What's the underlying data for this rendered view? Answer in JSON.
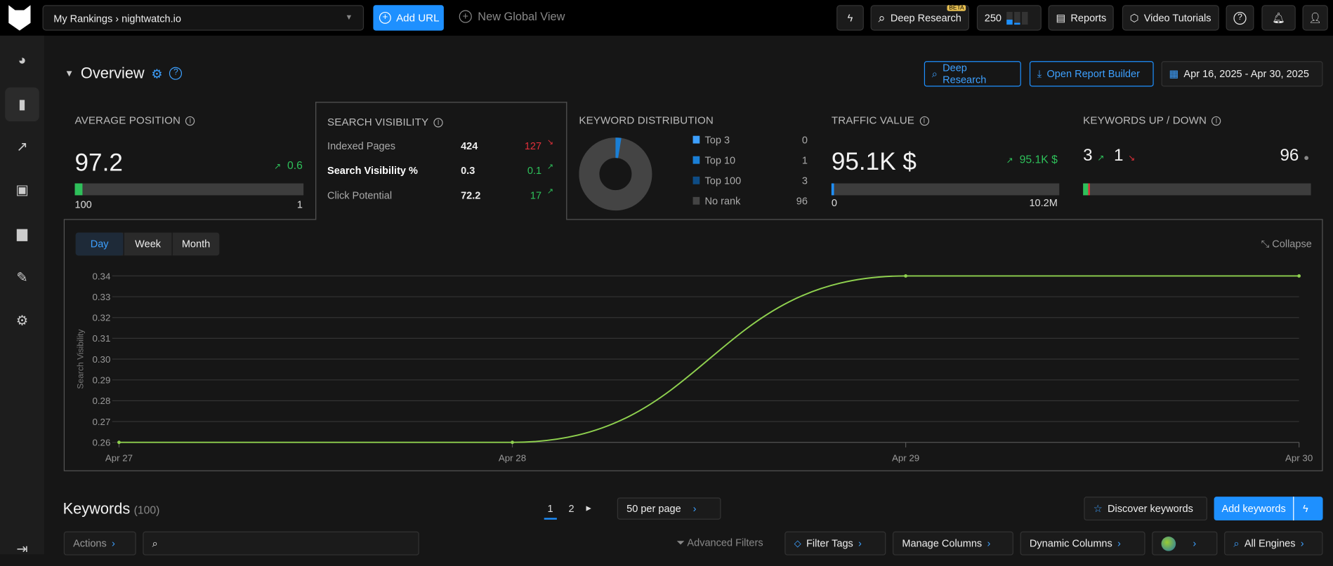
{
  "topbar": {
    "project_select": "My Rankings › nightwatch.io",
    "add_url": "Add URL",
    "new_global_view": "New Global View",
    "deep_research": "Deep Research",
    "beta_badge": "BETA",
    "credits": "250",
    "reports": "Reports",
    "video_tutorials": "Video Tutorials"
  },
  "overview": {
    "title": "Overview",
    "deep_research": "Deep Research",
    "open_report_builder": "Open Report Builder",
    "date_range": "Apr 16, 2025 - Apr 30, 2025"
  },
  "avg_position": {
    "title": "AVERAGE POSITION",
    "value": "97.2",
    "change": "0.6",
    "bar_min": "100",
    "bar_max": "1",
    "fill_fraction": 0.01
  },
  "search_visibility": {
    "title": "SEARCH VISIBILITY",
    "rows": [
      {
        "label": "Indexed Pages",
        "value": "424",
        "change": "127",
        "dir": "down"
      },
      {
        "label": "Search Visibility %",
        "value": "0.3",
        "change": "0.1",
        "dir": "up"
      },
      {
        "label": "Click Potential",
        "value": "72.2",
        "change": "17",
        "dir": "up"
      }
    ]
  },
  "keyword_distribution": {
    "title": "KEYWORD DISTRIBUTION",
    "items": [
      {
        "label": "Top 3",
        "value": "0",
        "color": "#3da0ff"
      },
      {
        "label": "Top 10",
        "value": "1",
        "color": "#1a7fd6"
      },
      {
        "label": "Top 100",
        "value": "3",
        "color": "#0e4c85"
      },
      {
        "label": "No rank",
        "value": "96",
        "color": "#444444"
      }
    ]
  },
  "traffic_value": {
    "title": "TRAFFIC VALUE",
    "value": "95.1K $",
    "change": "95.1K $",
    "bar_min": "0",
    "bar_max": "10.2M",
    "fill_fraction": 0.01
  },
  "keywords_updown": {
    "title": "KEYWORDS UP / DOWN",
    "up": "3",
    "down": "1",
    "unchanged": "96"
  },
  "chart_tabs": [
    "Day",
    "Week",
    "Month"
  ],
  "collapse": "Collapse",
  "chart_data": {
    "type": "line",
    "ylabel": "Search Visibility",
    "x": [
      "Apr 27",
      "Apr 28",
      "Apr 29",
      "Apr 30"
    ],
    "values": [
      0.26,
      0.26,
      0.34,
      0.34
    ],
    "ylim": [
      0.26,
      0.34
    ],
    "yticks": [
      "0.26",
      "0.27",
      "0.28",
      "0.29",
      "0.30",
      "0.31",
      "0.32",
      "0.33",
      "0.34"
    ],
    "grid": true,
    "color": "#8fd14f"
  },
  "keywords": {
    "title": "Keywords",
    "count": "(100)",
    "pages": [
      "1",
      "2"
    ],
    "per_page": "50 per page",
    "discover": "Discover keywords",
    "add": "Add keywords",
    "actions": "Actions",
    "advanced_filters": "Advanced Filters",
    "filter_tags": "Filter Tags",
    "manage_columns": "Manage Columns",
    "dynamic_columns": "Dynamic Columns",
    "all_engines": "All Engines"
  }
}
